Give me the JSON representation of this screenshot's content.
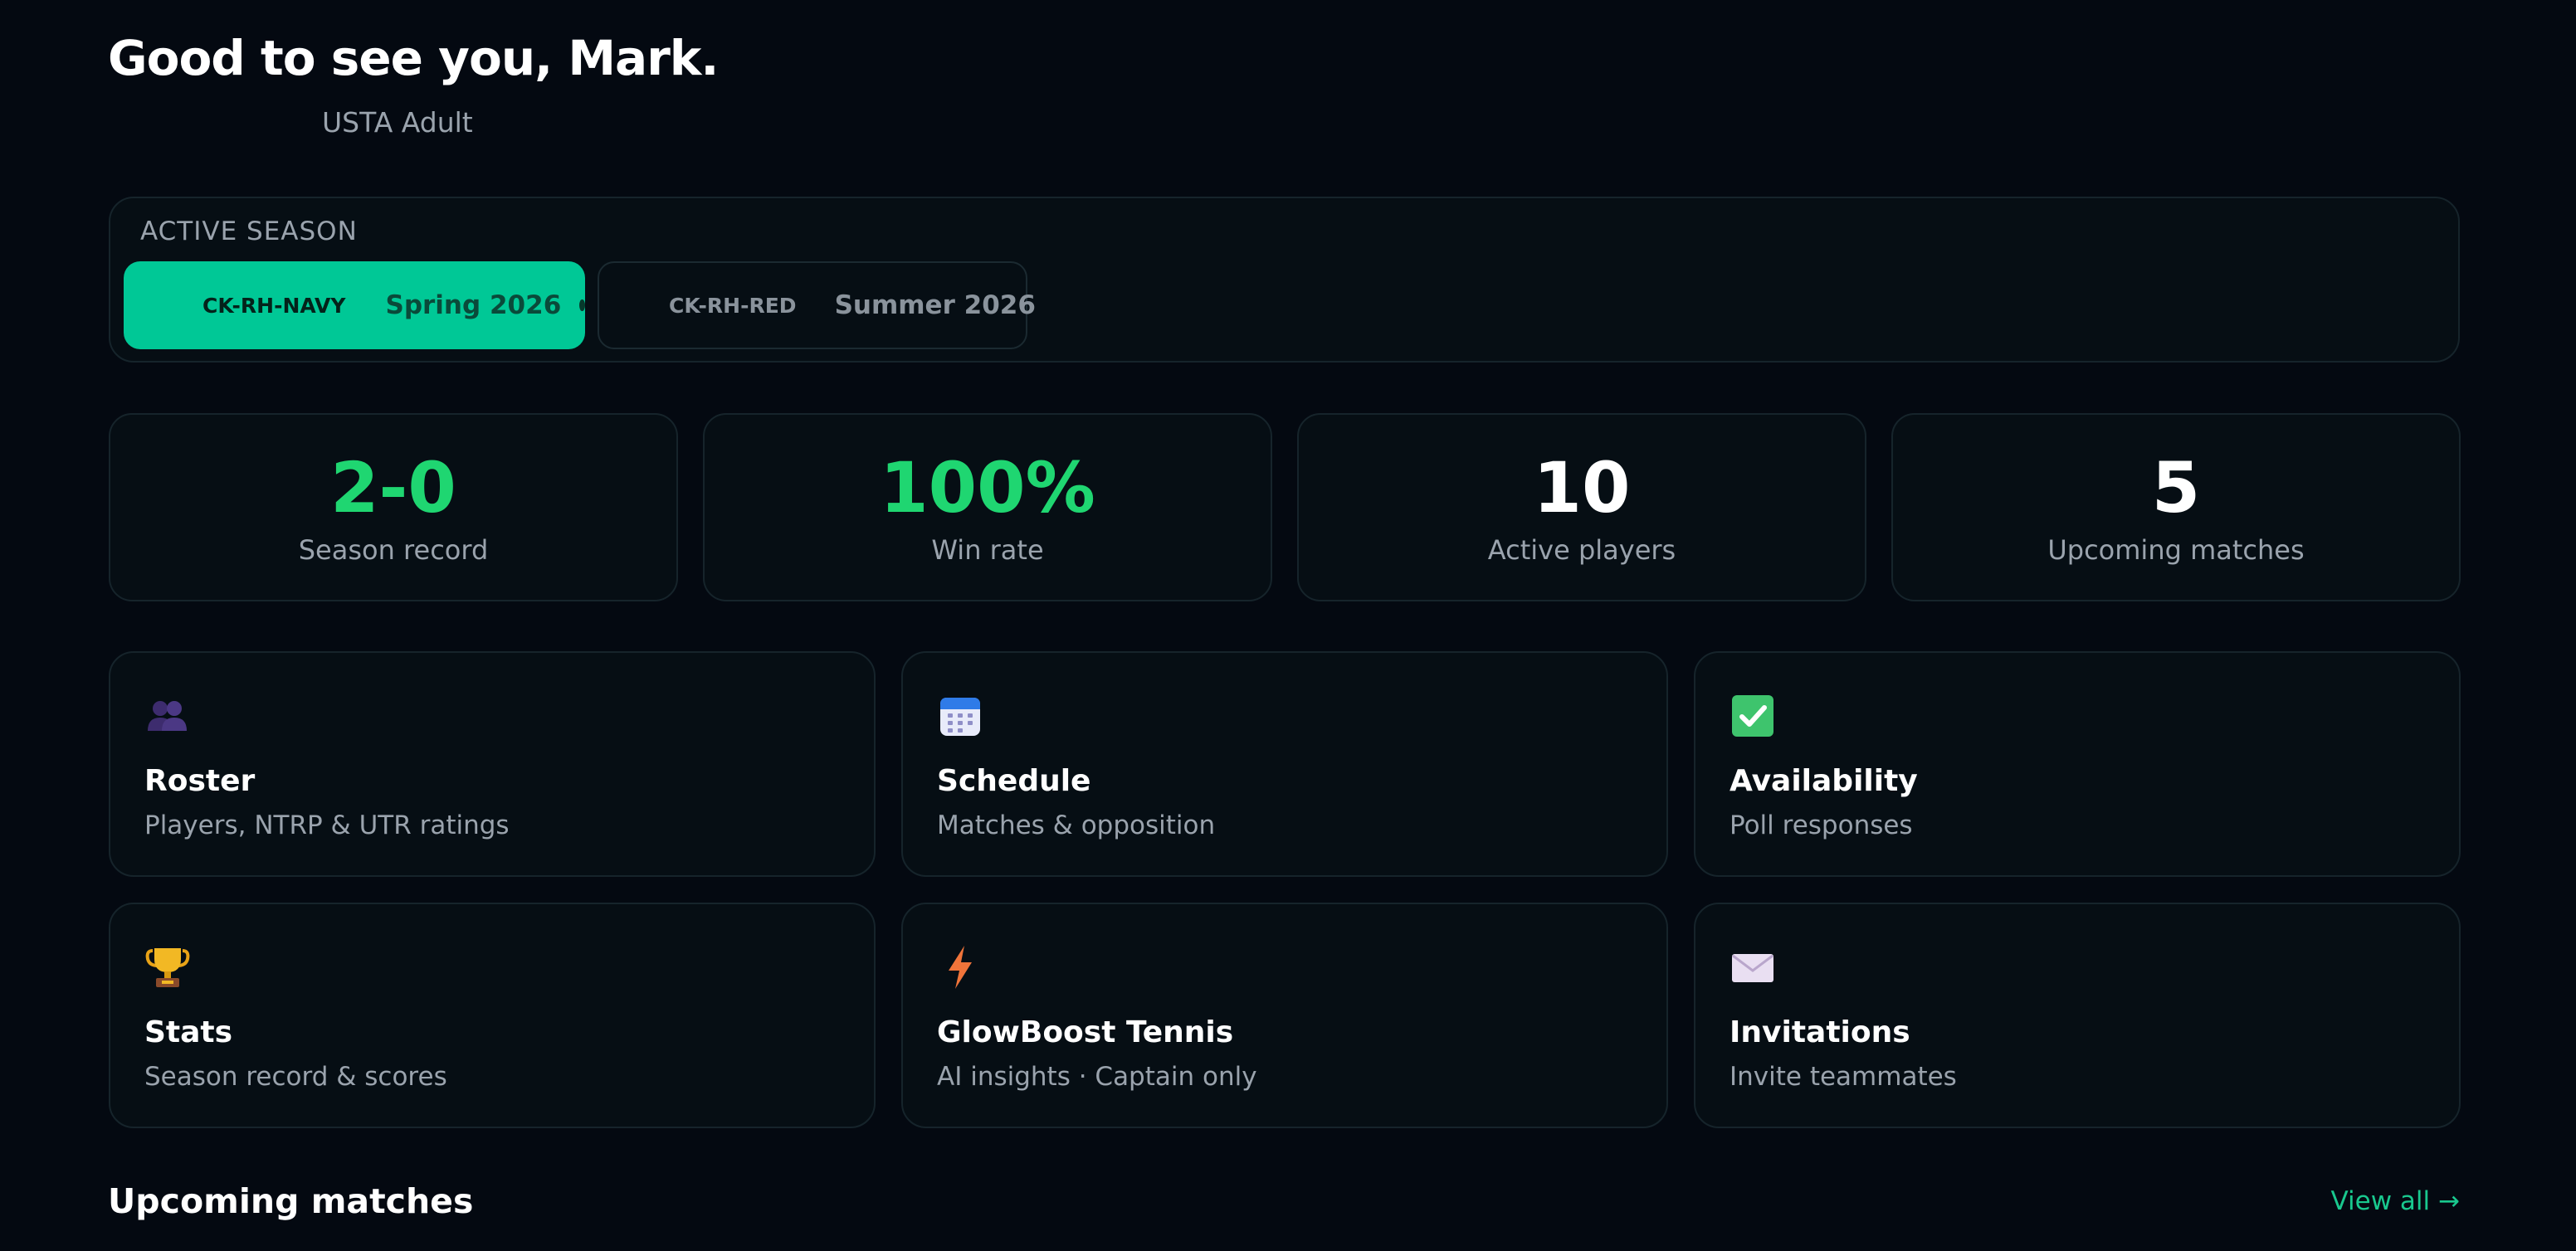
{
  "header": {
    "greeting": "Good to see you, Mark.",
    "league": "USTA Adult"
  },
  "active_season": {
    "label": "ACTIVE SEASON",
    "tabs": [
      {
        "code": "CK-RH-NAVY",
        "season": "Spring 2026",
        "selected": true
      },
      {
        "code": "CK-RH-RED",
        "season": "Summer 2026",
        "selected": false
      }
    ]
  },
  "stats": [
    {
      "value": "2-0",
      "label": "Season record",
      "color": "#1fd671"
    },
    {
      "value": "100%",
      "label": "Win rate",
      "color": "#1fd671"
    },
    {
      "value": "10",
      "label": "Active players",
      "color": "#ffffff"
    },
    {
      "value": "5",
      "label": "Upcoming matches",
      "color": "#ffffff"
    }
  ],
  "nav_cards": [
    {
      "title": "Roster",
      "subtitle": "Players, NTRP & UTR ratings",
      "icon": "people-icon"
    },
    {
      "title": "Schedule",
      "subtitle": "Matches & opposition",
      "icon": "calendar-icon"
    },
    {
      "title": "Availability",
      "subtitle": "Poll responses",
      "icon": "checkbox-icon"
    },
    {
      "title": "Stats",
      "subtitle": "Season record & scores",
      "icon": "trophy-icon"
    },
    {
      "title": "GlowBoost Tennis",
      "subtitle": "AI insights · Captain only",
      "icon": "lightning-icon"
    },
    {
      "title": "Invitations",
      "subtitle": "Invite teammates",
      "icon": "envelope-icon"
    }
  ],
  "upcoming": {
    "title": "Upcoming matches",
    "view_all": "View all →"
  },
  "colors": {
    "accent": "#00c896",
    "win_green": "#1fd671",
    "link": "#19c88e",
    "background": "#040911",
    "card": "#060e14"
  }
}
